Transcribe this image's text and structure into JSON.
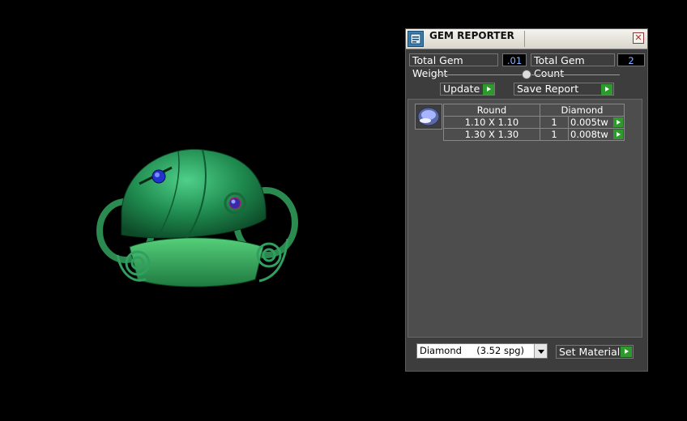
{
  "window": {
    "title": "GEM REPORTER",
    "close_glyph": "✕"
  },
  "stats": {
    "total_gem_weight_label": "Total Gem Weight",
    "total_gem_weight_value": ".01",
    "total_gem_count_label": "Total Gem Count",
    "total_gem_count_value": "2"
  },
  "actions": {
    "update_label": "Update",
    "save_report_label": "Save Report"
  },
  "gem_table": {
    "header_shape": "Round",
    "header_stone": "Diamond",
    "rows": [
      {
        "size": "1.10 X 1.10",
        "qty": "1",
        "weight": "0.005tw"
      },
      {
        "size": "1.30 X 1.30",
        "qty": "1",
        "weight": "0.008tw"
      }
    ]
  },
  "material": {
    "selected": "Diamond     (3.52 spg)",
    "set_label": "Set Material"
  },
  "colors": {
    "accent_green": "#2e9a2e",
    "value_blue": "#8ab4ff",
    "ring_green": "#2f9a5a"
  },
  "icons": [
    "gem-reporter-app-icon",
    "close-icon",
    "slider-thumb-icon",
    "play-arrow-icon",
    "gem-round-icon",
    "dropdown-arrow-icon"
  ]
}
